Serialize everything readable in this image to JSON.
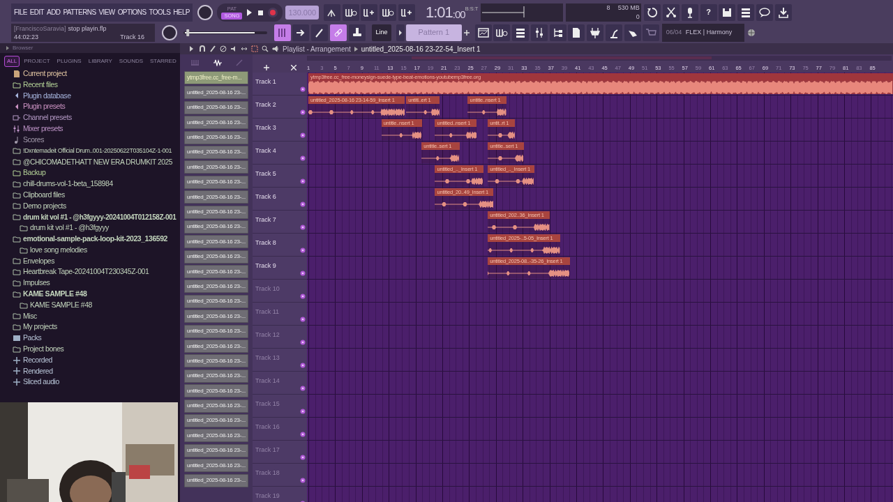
{
  "menu": [
    "FILE",
    "EDIT",
    "ADD",
    "PATTERNS",
    "VIEW",
    "OPTIONS",
    "TOOLS",
    "HELP"
  ],
  "project": {
    "user": "[FranciscoSaravia]",
    "file": "stop playin.flp",
    "elapsed": "44:02:23",
    "target": "Track 16"
  },
  "position": {
    "level": 0.02
  },
  "transport": {
    "modes": [
      {
        "label": "PAT",
        "selected": false
      },
      {
        "label": "SONG",
        "selected": true
      }
    ],
    "tempo": "130.000"
  },
  "time": {
    "main": "1:01",
    "sub": ":00",
    "unit": "B:S:T"
  },
  "monitor": {
    "voices": "8",
    "memory": "530 MB",
    "cpu": "0"
  },
  "tools": {
    "snap": "Line",
    "pattern": "Pattern 1",
    "help": "?"
  },
  "info": {
    "counter": "06/04",
    "text": "FLEX | Harmony"
  },
  "browser": {
    "title": "Browser",
    "tabs": [
      {
        "label": "ALL",
        "selected": true
      },
      {
        "label": "PROJECT",
        "selected": false
      },
      {
        "label": "PLUGINS",
        "selected": false
      },
      {
        "label": "LIBRARY",
        "selected": false
      },
      {
        "label": "SOUNDS",
        "selected": false
      },
      {
        "label": "STARRED",
        "selected": false
      }
    ],
    "items": [
      {
        "label": "Current project",
        "kind": "project"
      },
      {
        "label": "Recent files",
        "kind": "recent"
      },
      {
        "label": "Plugin database",
        "kind": "plugin"
      },
      {
        "label": "Plugin presets",
        "kind": "preset"
      },
      {
        "label": "Channel presets",
        "kind": "channel"
      },
      {
        "label": "Mixer presets",
        "kind": "mixer"
      },
      {
        "label": "Scores",
        "kind": "score"
      },
      {
        "label": "!Dxntemadeit Official Drum..001-20250622T035104Z-1-001",
        "kind": "folder"
      },
      {
        "label": "@CHICOMADETHATT NEW ERA DRUMKIT 2025",
        "kind": "folder"
      },
      {
        "label": "Backup",
        "kind": "recent"
      },
      {
        "label": "chill-drums-vol-1-beta_158984",
        "kind": "folder"
      },
      {
        "label": "Clipboard files",
        "kind": "folder"
      },
      {
        "label": "Demo projects",
        "kind": "folder"
      },
      {
        "label": "drum kit vol #1 - @h3fgyyy-20241004T012158Z-001",
        "kind": "folder",
        "children": [
          {
            "label": "drum kit vol #1 - @h3fgyyy",
            "kind": "folder"
          }
        ]
      },
      {
        "label": "emotional-sample-pack-loop-kit-2023_136592",
        "kind": "folder",
        "children": [
          {
            "label": "love song melodies",
            "kind": "folder"
          }
        ]
      },
      {
        "label": "Envelopes",
        "kind": "folder"
      },
      {
        "label": "Heartbreak Tape-20241004T230345Z-001",
        "kind": "folder"
      },
      {
        "label": "Impulses",
        "kind": "folder"
      },
      {
        "label": "KAME SAMPLE #48",
        "kind": "folder",
        "children": [
          {
            "label": "KAME SAMPLE #48",
            "kind": "folder"
          }
        ]
      },
      {
        "label": "Misc",
        "kind": "folder"
      },
      {
        "label": "My projects",
        "kind": "folder"
      },
      {
        "label": "Packs",
        "kind": "packs"
      },
      {
        "label": "Project bones",
        "kind": "folder"
      },
      {
        "label": "Recorded",
        "kind": "audio"
      },
      {
        "label": "Rendered",
        "kind": "audio"
      },
      {
        "label": "Sliced audio",
        "kind": "audio"
      }
    ]
  },
  "channels": [
    {
      "name": "ytmp3free.cc_free-m...",
      "selected": true
    },
    {
      "name": "untitled_2025-08-16 23-...",
      "selected": false
    },
    {
      "name": "untitled_2025-08-16 23-...",
      "selected": false
    },
    {
      "name": "untitled_2025-08-16 23-...",
      "selected": false
    },
    {
      "name": "untitled_2025-08-16 23-...",
      "selected": false
    },
    {
      "name": "untitled_2025-08-16 23-...",
      "selected": false
    },
    {
      "name": "untitled_2025-08-16 23-...",
      "selected": false
    },
    {
      "name": "untitled_2025-08-16 23-...",
      "selected": false
    },
    {
      "name": "untitled_2025-08-16 23-...",
      "selected": false
    },
    {
      "name": "untitled_2025-08-16 23-...",
      "selected": false
    },
    {
      "name": "untitled_2025-08-16 23-...",
      "selected": false
    },
    {
      "name": "untitled_2025-08-16 23-...",
      "selected": false
    },
    {
      "name": "untitled_2025-08-16 23-...",
      "selected": false
    },
    {
      "name": "untitled_2025-08-16 23-...",
      "selected": false
    },
    {
      "name": "untitled_2025-08-16 23-...",
      "selected": false
    },
    {
      "name": "untitled_2025-08-16 23-...",
      "selected": false
    },
    {
      "name": "untitled_2025-08-16 23-...",
      "selected": false
    },
    {
      "name": "untitled_2025-08-16 23-...",
      "selected": false
    },
    {
      "name": "untitled_2025-08-16 23-...",
      "selected": false
    },
    {
      "name": "untitled_2025-08-16 23-...",
      "selected": false
    },
    {
      "name": "untitled_2025-08-16 23-...",
      "selected": false
    },
    {
      "name": "untitled_2025-08-16 23-...",
      "selected": false
    },
    {
      "name": "untitled_2025-08-16 23-...",
      "selected": false
    },
    {
      "name": "untitled_2025-08-16 23-...",
      "selected": false
    },
    {
      "name": "untitled_2025-08-16 23-...",
      "selected": false
    },
    {
      "name": "untitled_2025-08-16 23-...",
      "selected": false
    },
    {
      "name": "untitled_2025-08-16 23-...",
      "selected": false
    },
    {
      "name": "untitled_2025-08-16 23-...",
      "selected": false
    }
  ],
  "playlist": {
    "title": "Playlist - Arrangement",
    "clip_name": "untitled_2025-08-16 23-22-54_Insert 1",
    "ruler": [
      "1",
      "3",
      "5",
      "7",
      "9",
      "11",
      "13",
      "15",
      "17",
      "19",
      "21",
      "23",
      "25",
      "27",
      "29",
      "31",
      "33",
      "35",
      "37",
      "39",
      "41",
      "43",
      "45",
      "47",
      "49",
      "51",
      "53",
      "55",
      "57",
      "59",
      "61",
      "63",
      "65",
      "67",
      "69",
      "71",
      "73",
      "75",
      "77",
      "79",
      "81",
      "83",
      "85"
    ],
    "tracks": [
      {
        "name": "Track 1",
        "clips": [
          {
            "label": "ytmp3free.cc_free-moneysign-suede-type-beat-emotions-youtubemp3free.org",
            "kind": "full"
          }
        ]
      },
      {
        "name": "Track 2",
        "clips": [
          {
            "label": "untitled_2025-08-16 23-14-59_Insert 1",
            "kind": "clip"
          },
          {
            "label": "untitl..ert 1",
            "kind": "clip"
          },
          {
            "label": "untitle..nsert 1",
            "kind": "clip"
          }
        ]
      },
      {
        "name": "Track 3",
        "clips": [
          {
            "label": "untitle..nsert 1",
            "kind": "clip"
          },
          {
            "label": "untitled..nsert 1",
            "kind": "clip"
          },
          {
            "label": "untit..rt 1",
            "kind": "clip"
          }
        ]
      },
      {
        "name": "Track 4",
        "clips": [
          {
            "label": "untitle..sert 1",
            "kind": "clip"
          },
          {
            "label": "untitle..sert 1",
            "kind": "clip"
          }
        ]
      },
      {
        "name": "Track 5",
        "clips": [
          {
            "label": "untitled_.._Insert 1",
            "kind": "clip"
          },
          {
            "label": "untitled_.._Insert 1",
            "kind": "clip"
          }
        ]
      },
      {
        "name": "Track 6",
        "clips": [
          {
            "label": "untitled_20..49_Insert 1",
            "kind": "clip"
          }
        ]
      },
      {
        "name": "Track 7",
        "clips": [
          {
            "label": "untitled_202..36_Insert 1",
            "kind": "clip"
          }
        ]
      },
      {
        "name": "Track 8",
        "clips": [
          {
            "label": "untitled_2025-..5-05_Insert 1",
            "kind": "clip"
          }
        ]
      },
      {
        "name": "Track 9",
        "clips": [
          {
            "label": "untitled_2025-08..-35-26_Insert 1",
            "kind": "clip"
          }
        ]
      },
      {
        "name": "Track 10"
      },
      {
        "name": "Track 11"
      },
      {
        "name": "Track 12"
      },
      {
        "name": "Track 13"
      },
      {
        "name": "Track 14"
      },
      {
        "name": "Track 15"
      },
      {
        "name": "Track 16"
      },
      {
        "name": "Track 17"
      },
      {
        "name": "Track 18"
      },
      {
        "name": "Track 19"
      }
    ]
  }
}
